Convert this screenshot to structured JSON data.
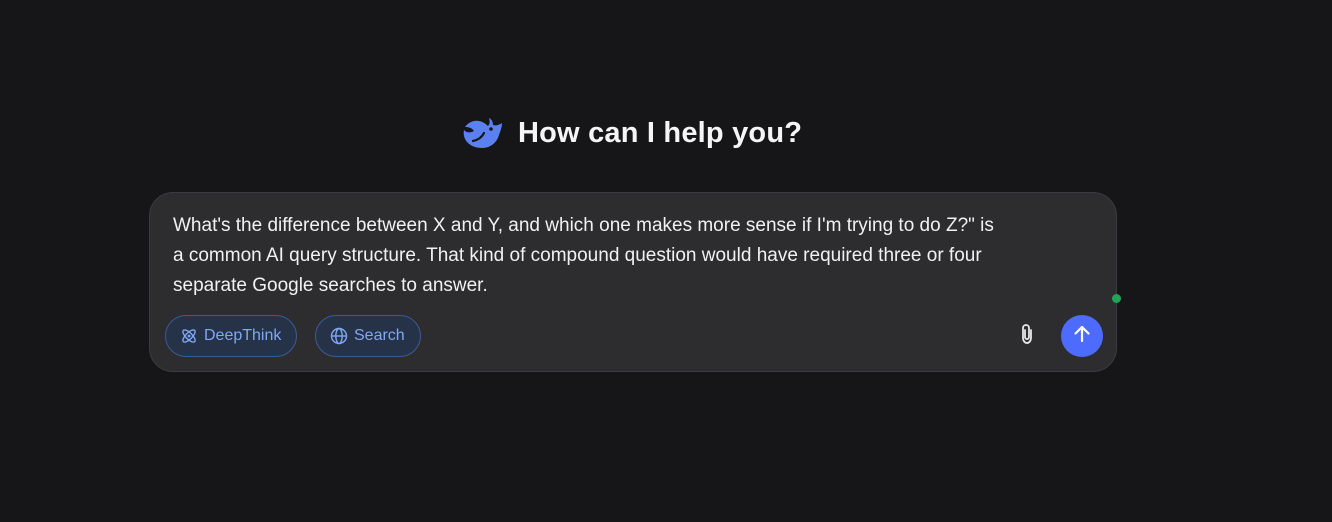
{
  "greeting": {
    "logo_icon": "whale-logo-icon",
    "title": "How can I help you?"
  },
  "composer": {
    "text": "What's the difference between X and Y, and which one makes more sense if I'm trying to do Z?\" is\na common AI query structure. That kind of compound question would have required three or four\nseparate Google searches to answer.",
    "buttons": {
      "deepthink": {
        "label": "DeepThink",
        "icon": "atom-icon"
      },
      "search": {
        "label": "Search",
        "icon": "globe-icon"
      },
      "attach": {
        "icon": "paperclip-icon"
      },
      "send": {
        "icon": "arrow-up-icon"
      }
    }
  },
  "colors": {
    "background": "#161618",
    "composer_bg": "#2d2d30",
    "accent": "#4d6bfe",
    "pill_text": "#7fa8f5",
    "status_dot": "#1fa45a"
  }
}
